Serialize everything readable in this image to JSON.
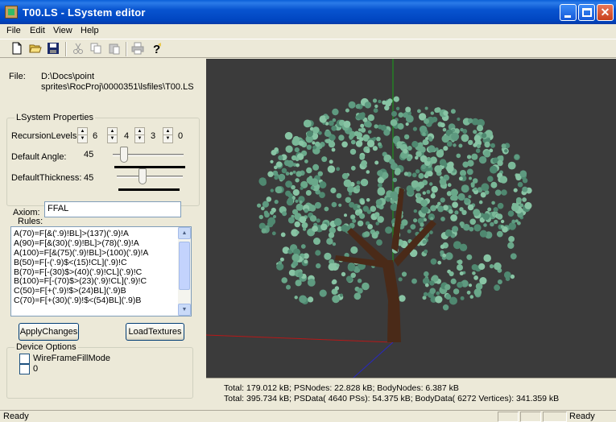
{
  "window": {
    "title": "T00.LS - LSystem editor"
  },
  "menu": [
    "File",
    "Edit",
    "View",
    "Help"
  ],
  "toolbar_icons": [
    "new-file-icon",
    "open-folder-icon",
    "save-disk-icon",
    "cut-icon",
    "copy-icon",
    "paste-icon",
    "print-icon",
    "help-icon"
  ],
  "file": {
    "label": "File:",
    "path_line1": "D:\\Docs\\point",
    "path_line2": "sprites\\RocProj\\0000351\\lsfiles\\T00.LS"
  },
  "properties": {
    "group_title": "LSystem Properties",
    "recursion_label": "RecursionLevels",
    "recursion_values": [
      "6",
      "4",
      "3",
      "0"
    ],
    "angle_label": "Default Angle:",
    "angle_value": "45",
    "thickness_label": "DefaultThickness:",
    "thickness_value": "45"
  },
  "axiom": {
    "label": "Axiom:",
    "value": "FFAL"
  },
  "rules": {
    "label": "Rules:",
    "items": [
      "A(70)=F[&('.9)!BL]>(137)('.9)!A",
      "A(90)=F[&(30)('.9)!BL]>(78)('.9)!A",
      "A(100)=F[&(75)('.9)!BL]>(100)('.9)!A",
      "B(50)=F[-('.9)$<(15)!CL]('.9)!C",
      "B(70)=F[-(30)$>(40)('.9)!CL]('.9)!C",
      "B(100)=F[-(70)$>(23)('.9)!CL]('.9)!C",
      "C(50)=F[+('.9)!$>(24)BL]('.9)B",
      "C(70)=F[+(30)('.9)!$<(54)BL]('.9)B"
    ]
  },
  "buttons": {
    "apply": "ApplyChanges",
    "load": "LoadTextures"
  },
  "device": {
    "group_title": "Device Options",
    "options": [
      "WireFrameFillMode",
      "0"
    ]
  },
  "stats": {
    "line1": "Total: 179.012 kB;  PSNodes: 22.828 kB;  BodyNodes: 6.387 kB",
    "line2": "Total: 395.734 kB;  PSData( 4640 PSs): 54.375 kB;  BodyData( 6272 Vertices): 341.359 kB"
  },
  "status": {
    "left": "Ready",
    "right": "Ready"
  },
  "colors": {
    "titlebar": "#0054e3",
    "viewport_bg": "#3b3b3b",
    "foliage": "#6aa88a",
    "trunk": "#4a2a18"
  }
}
